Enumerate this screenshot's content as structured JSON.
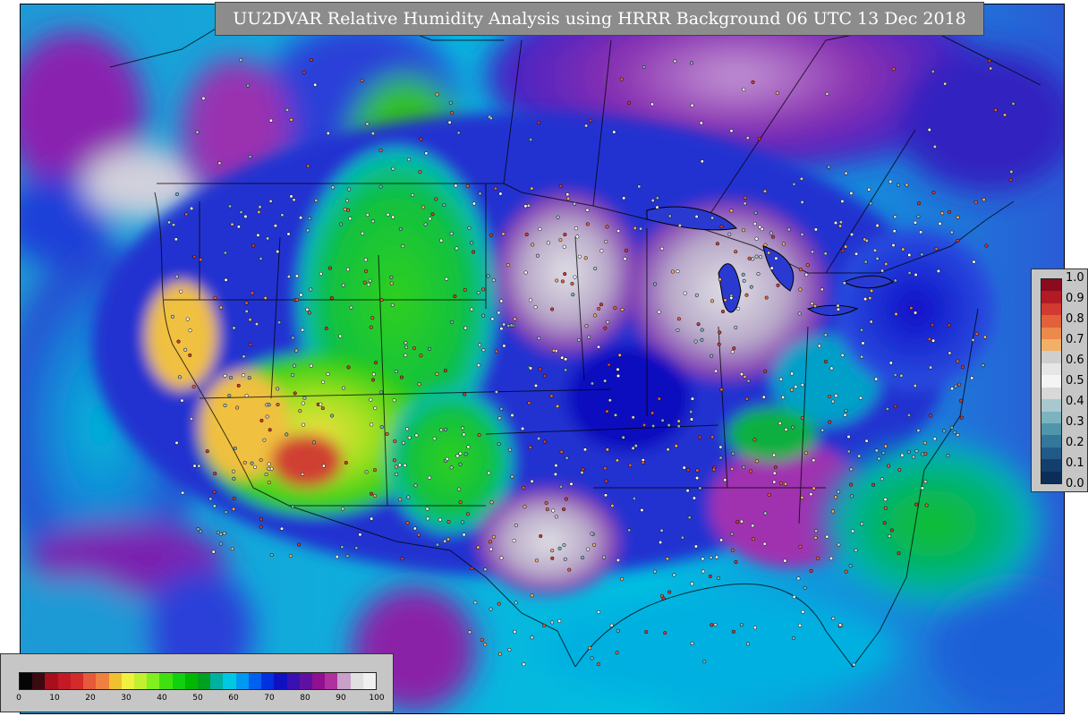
{
  "title": "UU2DVAR Relative Humidity Analysis using HRRR Background 06 UTC 13 Dec 2018",
  "station_legend": {
    "ticks": [
      "1.0",
      "0.9",
      "0.8",
      "0.7",
      "0.6",
      "0.5",
      "0.4",
      "0.3",
      "0.2",
      "0.1",
      "0.0"
    ],
    "colors": [
      "#8b0a1e",
      "#b31b24",
      "#d13a30",
      "#e2603a",
      "#eb8a4a",
      "#f2b066",
      "#cfcfcf",
      "#e6e6e6",
      "#f4f4f4",
      "#d8d8d8",
      "#a8c8cf",
      "#7cb3bf",
      "#4f96ab",
      "#33779a",
      "#215a86",
      "#143f6c",
      "#0b2d58"
    ]
  },
  "rh_colorbar": {
    "ticks": [
      "0",
      "10",
      "20",
      "30",
      "40",
      "50",
      "60",
      "70",
      "80",
      "90",
      "100"
    ],
    "colors": [
      "#050505",
      "#3a0a10",
      "#a80f1a",
      "#c41a26",
      "#d42a2a",
      "#e55a3a",
      "#f08040",
      "#f0c030",
      "#f0f040",
      "#c0f030",
      "#80f020",
      "#40e010",
      "#10d010",
      "#00b800",
      "#00a020",
      "#00b0a0",
      "#00c8e0",
      "#0098f0",
      "#0060f0",
      "#0030e0",
      "#1010c0",
      "#3a10b0",
      "#6010a0",
      "#901090",
      "#b030a0",
      "#c8a0c8",
      "#e0e0e0",
      "#f0f0f0"
    ]
  },
  "map": {
    "ocean_colors": [
      "#1e9ad6",
      "#00bfe0",
      "#2a5bd6",
      "#6a20a8"
    ],
    "land_colors": [
      "#1a2ad0",
      "#00b8d8",
      "#18c818",
      "#a0e020",
      "#f0e040",
      "#d03020",
      "#9a2aa8",
      "#d0d0d8"
    ]
  }
}
